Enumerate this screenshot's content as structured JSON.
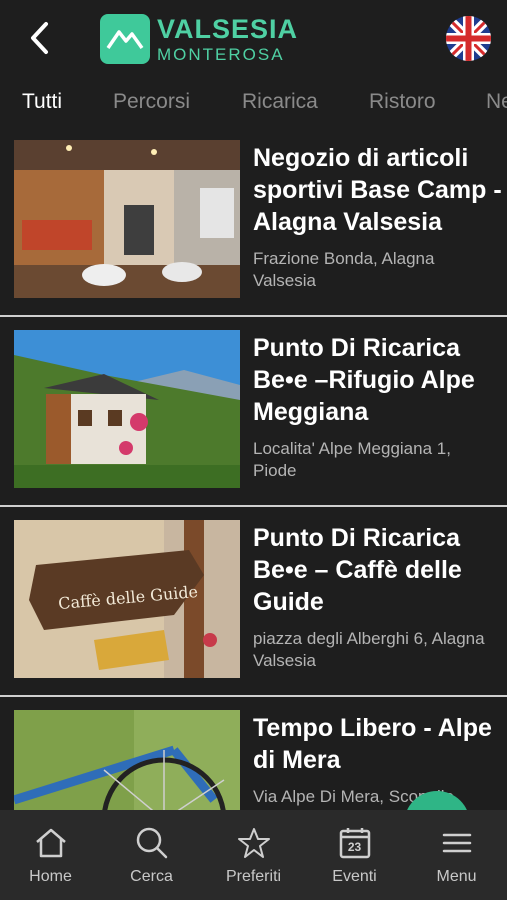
{
  "header": {
    "logo_top": "VALSESIA",
    "logo_bottom": "MONTEROSA"
  },
  "tabs": [
    {
      "label": "Tutti",
      "active": true
    },
    {
      "label": "Percorsi"
    },
    {
      "label": "Ricarica"
    },
    {
      "label": "Ristoro"
    },
    {
      "label": "Ne"
    }
  ],
  "items": [
    {
      "title": "Negozio di articoli sportivi Base Camp - Alagna Valsesia",
      "address": "Frazione Bonda, Alagna Valsesia"
    },
    {
      "title": "Punto Di Ricarica Be•e –Rifugio Alpe Meggiana",
      "address": "Localita' Alpe Meggiana 1, Piode"
    },
    {
      "title": "Punto Di Ricarica Be•e – Caffè delle Guide",
      "address": "piazza degli Alberghi 6, Alagna Valsesia",
      "sign_text": "Caffè delle Guide"
    },
    {
      "title": "Tempo Libero - Alpe di Mera",
      "address": "Via Alpe Di Mera, Scopello"
    }
  ],
  "bottom_nav": [
    {
      "label": "Home",
      "icon": "home-icon"
    },
    {
      "label": "Cerca",
      "icon": "search-icon"
    },
    {
      "label": "Preferiti",
      "icon": "star-icon"
    },
    {
      "label": "Eventi",
      "icon": "calendar-icon",
      "day": "23"
    },
    {
      "label": "Menu",
      "icon": "menu-icon"
    }
  ],
  "colors": {
    "background": "#1e1e1e",
    "accent": "#3fc99a",
    "nav_background": "#2a2a2a"
  }
}
